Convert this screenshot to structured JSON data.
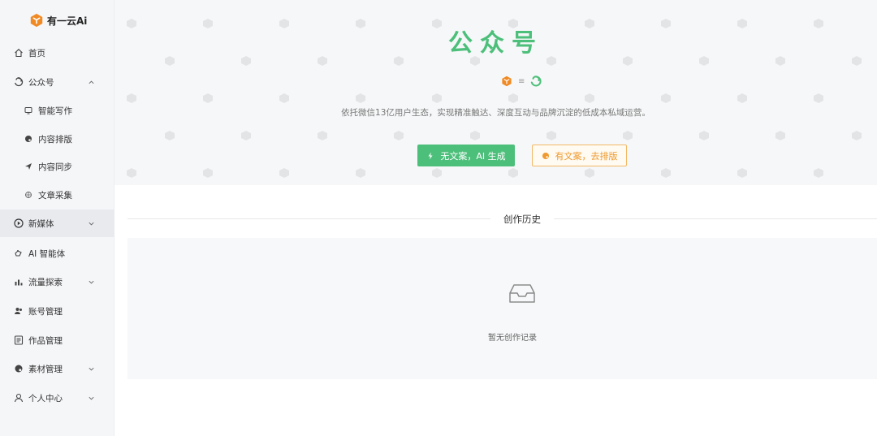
{
  "brand": {
    "name": "有一云Ai"
  },
  "sidebar": {
    "items": [
      {
        "label": "首页",
        "icon": "home-icon"
      },
      {
        "label": "公众号",
        "icon": "wechat-official-icon",
        "expanded": true
      },
      {
        "label": "智能写作",
        "icon": "tv-icon"
      },
      {
        "label": "内容排版",
        "icon": "palette-icon"
      },
      {
        "label": "内容同步",
        "icon": "send-icon"
      },
      {
        "label": "文章采集",
        "icon": "collect-icon"
      },
      {
        "label": "新媒体",
        "icon": "play-circle-icon",
        "active": true
      },
      {
        "label": "AI 智能体",
        "icon": "robot-icon"
      },
      {
        "label": "流量探索",
        "icon": "bar-chart-icon"
      },
      {
        "label": "账号管理",
        "icon": "users-icon"
      },
      {
        "label": "作品管理",
        "icon": "document-icon"
      },
      {
        "label": "素材管理",
        "icon": "palette-icon"
      },
      {
        "label": "个人中心",
        "icon": "user-icon"
      }
    ]
  },
  "hero": {
    "title": "公众号",
    "connector": "≡",
    "description": "依托微信13亿用户生态，实现精准触达、深度互动与品牌沉淀的低成本私域运营。",
    "primary_button": "无文案，AI 生成",
    "secondary_button": "有文案，去排版"
  },
  "history": {
    "title": "创作历史",
    "empty_text": "暂无创作记录"
  },
  "colors": {
    "accent_green": "#4cbf7a",
    "accent_orange": "#ee9a2e",
    "sidebar_bg": "#f5f6f8"
  }
}
